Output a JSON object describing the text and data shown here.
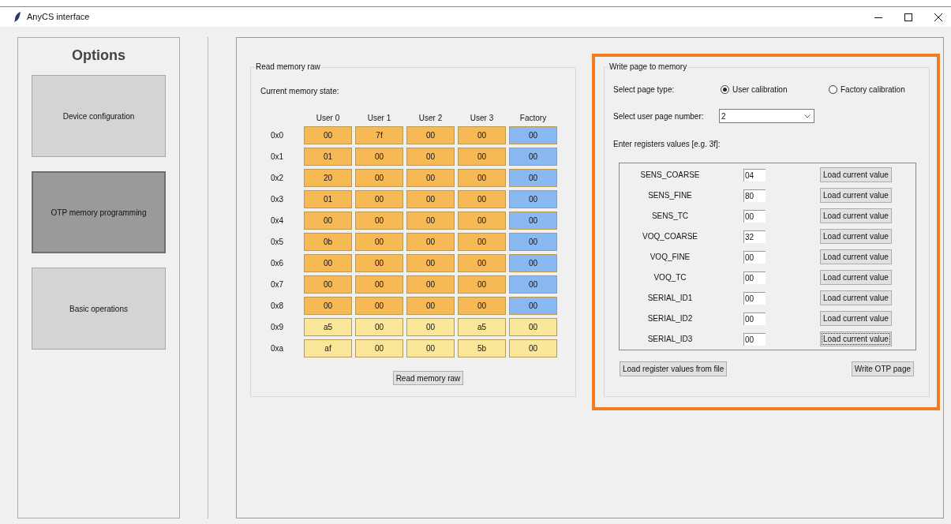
{
  "window": {
    "title": "AnyCS interface"
  },
  "sidebar": {
    "title": "Options",
    "items": [
      {
        "label": "Device configuration",
        "selected": false
      },
      {
        "label": "OTP memory programming",
        "selected": true
      },
      {
        "label": "Basic operations",
        "selected": false
      }
    ]
  },
  "read_memory": {
    "title": "Read memory raw",
    "caption": "Current memory state:",
    "columns": [
      "User 0",
      "User 1",
      "User 2",
      "User 3",
      "Factory"
    ],
    "rows": [
      {
        "address": "0x0",
        "cells": [
          {
            "value": "00",
            "color": "#f7b955"
          },
          {
            "value": "7f",
            "color": "#f7b955"
          },
          {
            "value": "00",
            "color": "#f7b955"
          },
          {
            "value": "00",
            "color": "#f7b955"
          },
          {
            "value": "00",
            "color": "#8ab8f2"
          }
        ]
      },
      {
        "address": "0x1",
        "cells": [
          {
            "value": "01",
            "color": "#f7b955"
          },
          {
            "value": "00",
            "color": "#f7b955"
          },
          {
            "value": "00",
            "color": "#f7b955"
          },
          {
            "value": "00",
            "color": "#f7b955"
          },
          {
            "value": "00",
            "color": "#8ab8f2"
          }
        ]
      },
      {
        "address": "0x2",
        "cells": [
          {
            "value": "20",
            "color": "#f7b955"
          },
          {
            "value": "00",
            "color": "#f7b955"
          },
          {
            "value": "00",
            "color": "#f7b955"
          },
          {
            "value": "00",
            "color": "#f7b955"
          },
          {
            "value": "00",
            "color": "#8ab8f2"
          }
        ]
      },
      {
        "address": "0x3",
        "cells": [
          {
            "value": "01",
            "color": "#f7b955"
          },
          {
            "value": "00",
            "color": "#f7b955"
          },
          {
            "value": "00",
            "color": "#f7b955"
          },
          {
            "value": "00",
            "color": "#f7b955"
          },
          {
            "value": "00",
            "color": "#8ab8f2"
          }
        ]
      },
      {
        "address": "0x4",
        "cells": [
          {
            "value": "00",
            "color": "#f7b955"
          },
          {
            "value": "00",
            "color": "#f7b955"
          },
          {
            "value": "00",
            "color": "#f7b955"
          },
          {
            "value": "00",
            "color": "#f7b955"
          },
          {
            "value": "00",
            "color": "#8ab8f2"
          }
        ]
      },
      {
        "address": "0x5",
        "cells": [
          {
            "value": "0b",
            "color": "#f7b955"
          },
          {
            "value": "00",
            "color": "#f7b955"
          },
          {
            "value": "00",
            "color": "#f7b955"
          },
          {
            "value": "00",
            "color": "#f7b955"
          },
          {
            "value": "00",
            "color": "#8ab8f2"
          }
        ]
      },
      {
        "address": "0x6",
        "cells": [
          {
            "value": "00",
            "color": "#f7b955"
          },
          {
            "value": "00",
            "color": "#f7b955"
          },
          {
            "value": "00",
            "color": "#f7b955"
          },
          {
            "value": "00",
            "color": "#f7b955"
          },
          {
            "value": "00",
            "color": "#8ab8f2"
          }
        ]
      },
      {
        "address": "0x7",
        "cells": [
          {
            "value": "00",
            "color": "#f7b955"
          },
          {
            "value": "00",
            "color": "#f7b955"
          },
          {
            "value": "00",
            "color": "#f7b955"
          },
          {
            "value": "00",
            "color": "#f7b955"
          },
          {
            "value": "00",
            "color": "#8ab8f2"
          }
        ]
      },
      {
        "address": "0x8",
        "cells": [
          {
            "value": "00",
            "color": "#f7b955"
          },
          {
            "value": "00",
            "color": "#f7b955"
          },
          {
            "value": "00",
            "color": "#f7b955"
          },
          {
            "value": "00",
            "color": "#f7b955"
          },
          {
            "value": "00",
            "color": "#8ab8f2"
          }
        ]
      },
      {
        "address": "0x9",
        "cells": [
          {
            "value": "a5",
            "color": "#fae79a"
          },
          {
            "value": "00",
            "color": "#fae79a"
          },
          {
            "value": "00",
            "color": "#fae79a"
          },
          {
            "value": "a5",
            "color": "#fae79a"
          },
          {
            "value": "00",
            "color": "#fae79a"
          }
        ]
      },
      {
        "address": "0xa",
        "cells": [
          {
            "value": "af",
            "color": "#fae79a"
          },
          {
            "value": "00",
            "color": "#fae79a"
          },
          {
            "value": "00",
            "color": "#fae79a"
          },
          {
            "value": "5b",
            "color": "#fae79a"
          },
          {
            "value": "00",
            "color": "#fae79a"
          }
        ]
      }
    ],
    "button": "Read memory raw"
  },
  "write_page": {
    "title": "Write page to memory",
    "page_type_label": "Select page type:",
    "page_types": [
      {
        "label": "User calibration",
        "selected": true
      },
      {
        "label": "Factory calibration",
        "selected": false
      }
    ],
    "page_number_label": "Select user page number:",
    "page_number": {
      "value": "2"
    },
    "registers_label": "Enter registers values [e.g. 3f]:",
    "registers": [
      {
        "name": "SENS_COARSE",
        "value": "04",
        "button": "Load current value",
        "focused": false
      },
      {
        "name": "SENS_FINE",
        "value": "80",
        "button": "Load current value",
        "focused": false
      },
      {
        "name": "SENS_TC",
        "value": "00",
        "button": "Load current value",
        "focused": false
      },
      {
        "name": "VOQ_COARSE",
        "value": "32",
        "button": "Load current value",
        "focused": false
      },
      {
        "name": "VOQ_FINE",
        "value": "00",
        "button": "Load current value",
        "focused": false
      },
      {
        "name": "VOQ_TC",
        "value": "00",
        "button": "Load current value",
        "focused": false
      },
      {
        "name": "SERIAL_ID1",
        "value": "00",
        "button": "Load current value",
        "focused": false
      },
      {
        "name": "SERIAL_ID2",
        "value": "00",
        "button": "Load current value",
        "focused": false
      },
      {
        "name": "SERIAL_ID3",
        "value": "00",
        "button": "Load current value",
        "focused": true
      }
    ],
    "load_file_button": "Load register values from file",
    "write_button": "Write OTP page"
  }
}
